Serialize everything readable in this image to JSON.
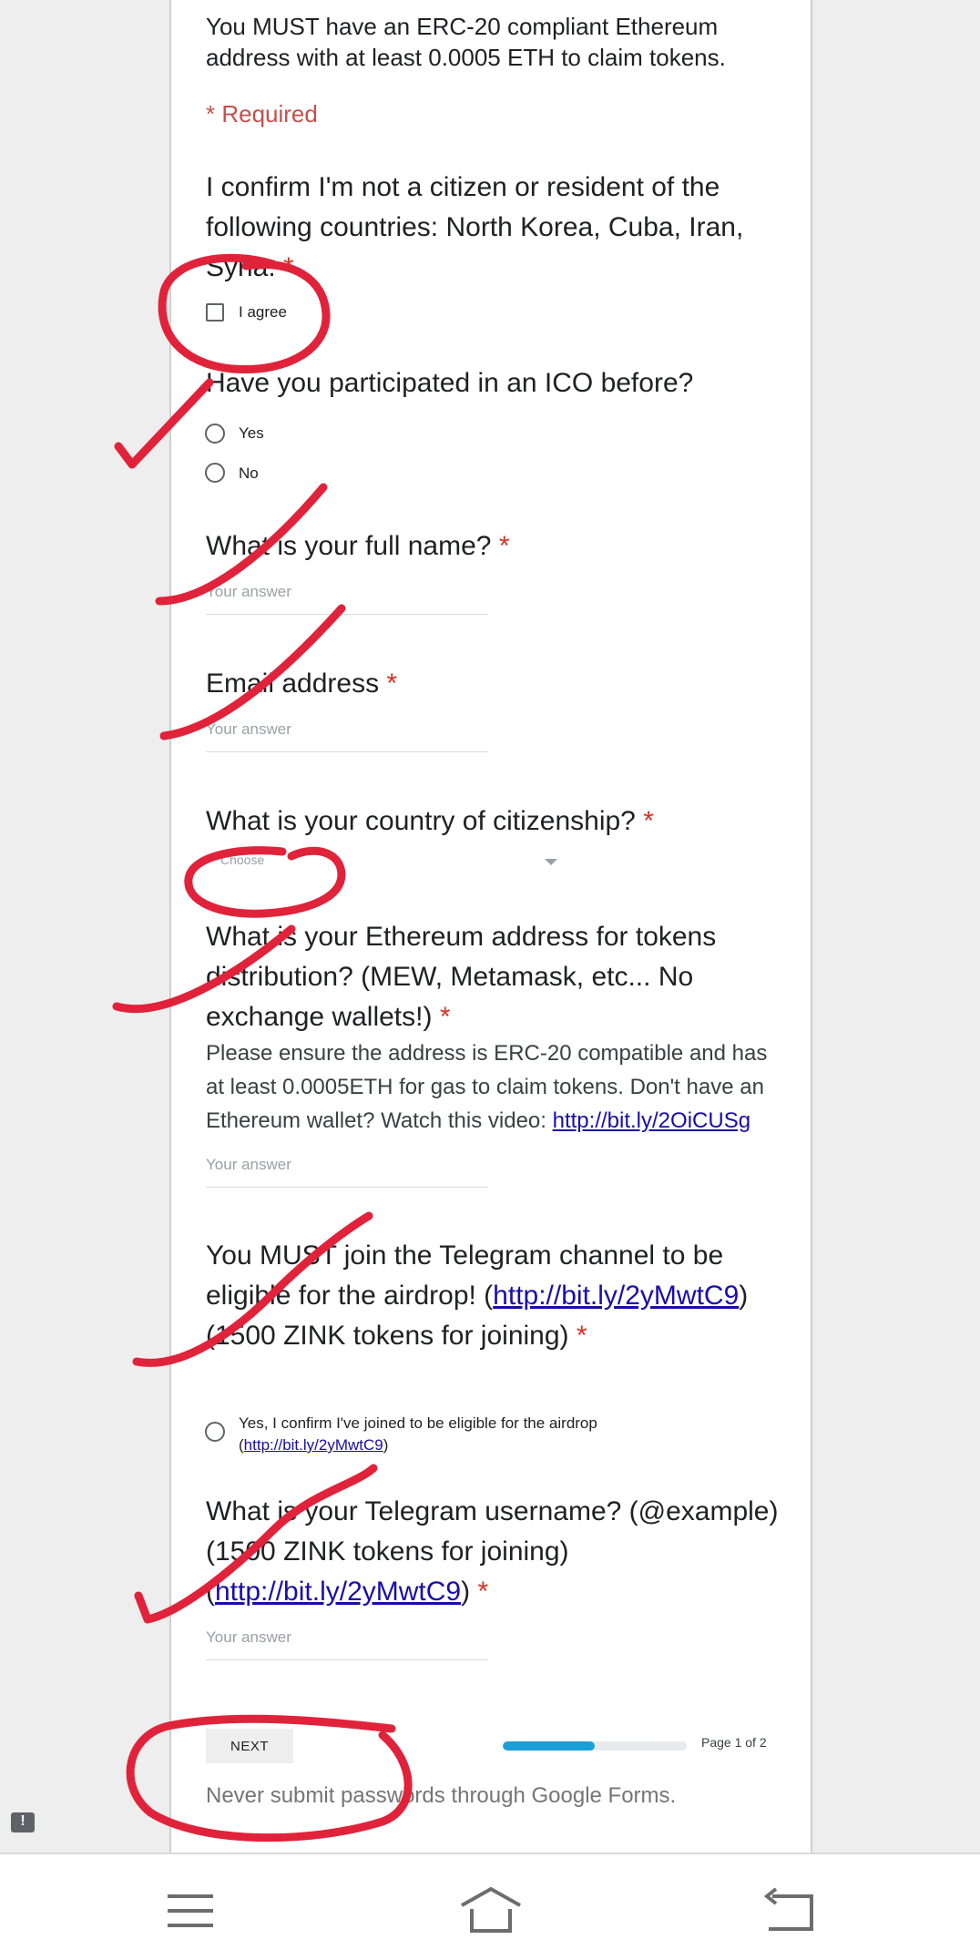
{
  "form": {
    "intro": "You MUST have an ERC-20 compliant Ethereum address with at least 0.0005 ETH to claim tokens.",
    "required_note": "* Required",
    "q1": {
      "title": "I confirm I'm not a citizen or resident of the following countries: North Korea, Cuba, Iran, Syria.",
      "star": "*",
      "option": "I agree"
    },
    "q2": {
      "title": "Have you participated in an ICO before?",
      "options": [
        "Yes",
        "No"
      ]
    },
    "q3": {
      "title": "What is your full name?",
      "star": "*",
      "placeholder": "Your answer"
    },
    "q4": {
      "title": "Email address",
      "star": "*",
      "placeholder": "Your answer"
    },
    "q5": {
      "title": "What is your country of citizenship?",
      "star": "*",
      "select_value": "Choose"
    },
    "q6": {
      "title": "What is your Ethereum address for tokens distribution? (MEW, Metamask, etc... No exchange wallets!)",
      "star": "*",
      "help": "Please ensure the address is ERC-20 compatible and has at least 0.0005ETH for gas to claim tokens. Don't have an Ethereum wallet? Watch this video: ",
      "help_link": "http://bit.ly/2OiCUSg",
      "placeholder": "Your answer"
    },
    "q7": {
      "title_pre": "You MUST join the Telegram channel to be eligible for the airdrop! (",
      "link": "http://bit.ly/2yMwtC9",
      "title_post": ") (1500 ZINK tokens for joining)",
      "star": "*",
      "option_pre": "Yes, I confirm I've joined to be eligible for the airdrop (",
      "option_link": "http://bit.ly/2yMwtC9",
      "option_post": ")"
    },
    "q8": {
      "title_pre": "What is your Telegram username? (@example) (1500 ZINK tokens for joining) (",
      "link": "http://bit.ly/2yMwtC9",
      "title_post": ")",
      "star": "*",
      "placeholder": "Your answer"
    },
    "next_label": "NEXT",
    "progress_fraction": 0.5,
    "page_indicator": "Page 1 of 2",
    "footer_note": "Never submit passwords through Google Forms.",
    "report_icon": "!"
  },
  "navbar": {
    "icons": [
      "menu-icon",
      "home-icon",
      "back-icon"
    ]
  },
  "colors": {
    "required": "#d93025",
    "link": "#1a0dab",
    "progress": "#1a9fd9",
    "annotation": "#e0233a"
  }
}
